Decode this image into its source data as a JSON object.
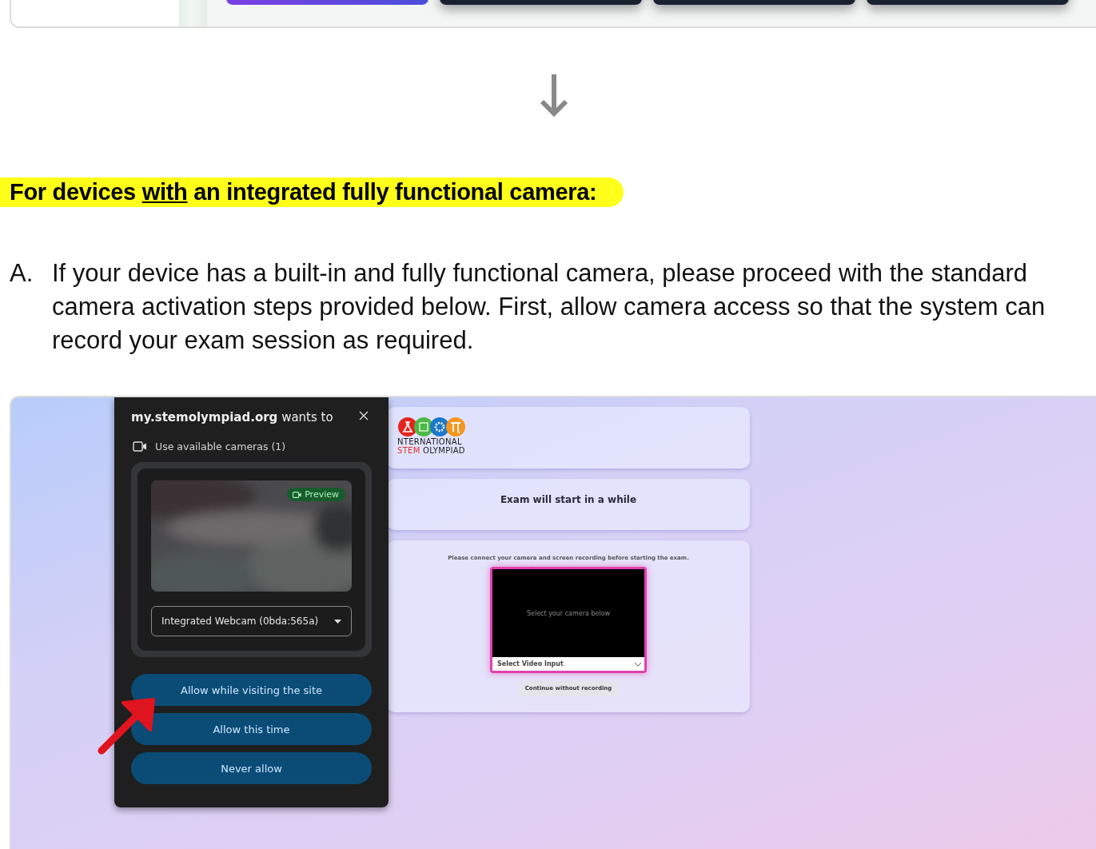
{
  "top_frame": {
    "buttons": [
      {
        "kind": "accent"
      },
      {
        "kind": "dark"
      },
      {
        "kind": "dark"
      },
      {
        "kind": "dark"
      }
    ]
  },
  "heading": {
    "before": "For devices",
    "underlined": "with",
    "after": "an integrated fully functional camera:"
  },
  "steps": [
    {
      "marker": "A.",
      "text": "If your device has a built-in and fully functional camera, please proceed with the standard camera activation steps provided below. First, allow camera access so that the system can record your exam session as required."
    }
  ],
  "screenshot": {
    "dialog": {
      "site": "my.stemolympiad.org",
      "title_rest": "wants to",
      "permission": "Use available cameras (1)",
      "preview_badge": "Preview",
      "camera_select": "Integrated Webcam (0bda:565a)",
      "buttons": [
        {
          "label": "Allow while visiting the site"
        },
        {
          "label": "Allow this time"
        },
        {
          "label": "Never allow"
        }
      ]
    },
    "logo": {
      "line_1": "NTERNATIONAL",
      "line_2_accent": "STEM",
      "line_2": "OLYMPIAD"
    },
    "status_title": "Exam will start in a while",
    "camera_card": {
      "instruction": "Please connect your camera and screen recording before starting the exam.",
      "video_placeholder": "Select your camera below",
      "video_select": "Select Video Input",
      "skip_button": "Continue without recording"
    }
  }
}
